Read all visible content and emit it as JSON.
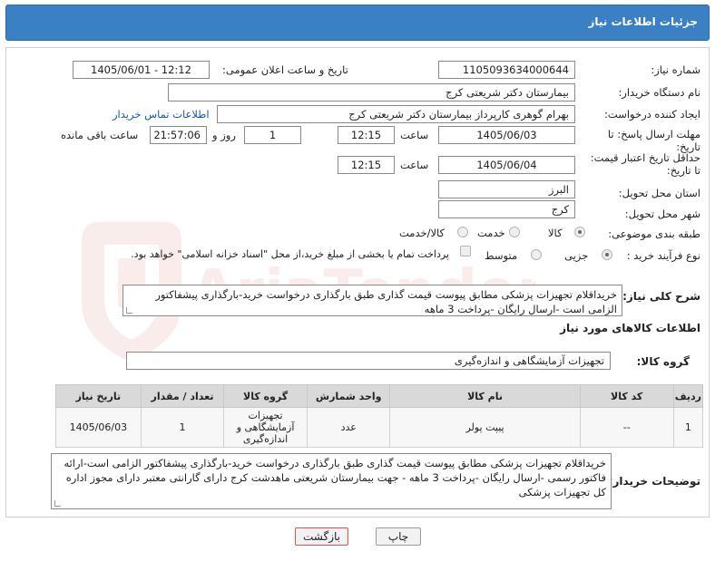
{
  "header": {
    "title": "جزئیات اطلاعات نیاز"
  },
  "need": {
    "number_label": "شماره نیاز:",
    "number": "1105093634000644",
    "announce_label": "تاریخ و ساعت اعلان عمومی:",
    "announce": "1405/06/01 - 12:12",
    "buyer_label": "نام دستگاه خریدار:",
    "buyer": "بیمارستان دکتر شریعتی کرج",
    "creator_label": "ایجاد کننده درخواست:",
    "creator": "بهرام گوهری کارپرداز بیمارستان دکتر شریعتی کرج",
    "contact_link": "اطلاعات تماس خریدار",
    "deadline_label_1": "مهلت ارسال پاسخ: تا",
    "deadline_label_2": "تاریخ:",
    "deadline_date": "1405/06/03",
    "time_label": "ساعت",
    "deadline_time": "12:15",
    "days_value": "1",
    "days_label": "روز و",
    "remaining_time": "21:57:06",
    "remaining_label": "ساعت باقی مانده",
    "validity_label_1": "حداقل تاریخ اعتبار قیمت:",
    "validity_label_2": "تا تاریخ:",
    "validity_date": "1405/06/04",
    "validity_time": "12:15",
    "province_label": "استان محل تحویل:",
    "province": "البرز",
    "city_label": "شهر محل تحویل:",
    "city": "کرج",
    "category_label": "طبقه بندی موضوعی:",
    "category_options": [
      "کالا",
      "خدمت",
      "کالا/خدمت"
    ],
    "process_label": "نوع فرآیند خرید :",
    "process_options": [
      "جزیی",
      "متوسط"
    ],
    "payment_note": "پرداخت تمام یا بخشی از مبلغ خرید،از محل \"اسناد خزانه اسلامی\" خواهد بود."
  },
  "summary": {
    "label": "شرح کلی نیاز:",
    "text": "خریداقلام تجهیزات پزشکی  مطابق پیوست   قیمت گذاری طبق بارگذاری درخواست خرید-بارگذاری پیشفاکتور الزامی است -ارسال رایگان -پرداخت 3 ماهه"
  },
  "goods": {
    "section_title": "اطلاعات کالاهای مورد نیاز",
    "group_label": "گروه کالا:",
    "group_value": "تجهیزات آزمایشگاهی و اندازه‌گیری",
    "columns": [
      "ردیف",
      "کد کالا",
      "نام کالا",
      "واحد شمارش",
      "گروه کالا",
      "تعداد / مقدار",
      "تاریخ نیاز"
    ],
    "rows": [
      {
        "row": "1",
        "code": "--",
        "name": "پیپت پولر",
        "unit": "عدد",
        "group": "تجهیزات آزمایشگاهی و اندازه‌گیری",
        "qty": "1",
        "date": "1405/06/03"
      }
    ]
  },
  "buyer_notes": {
    "label": "توضیحات خریدار:",
    "text": "خریداقلام تجهیزات پزشکی  مطابق پیوست   قیمت گذاری طبق بارگذاری درخواست خرید-بارگذاری پیشفاکتور الزامی است-ارائه فاکتور رسمی -ارسال رایگان -پرداخت 3 ماهه - جهت بیمارستان شریعتی ماهدشت کرج دارای گارانتی معتبر دارای مجوز اداره کل تجهیزات پزشکی"
  },
  "buttons": {
    "print": "چاپ",
    "back": "بازگشت"
  },
  "watermark": {
    "text": "AriaTender.net"
  },
  "colors": {
    "header": "#3b7fc4",
    "back_button_border": "#d9534f",
    "link": "#1a56b0"
  }
}
